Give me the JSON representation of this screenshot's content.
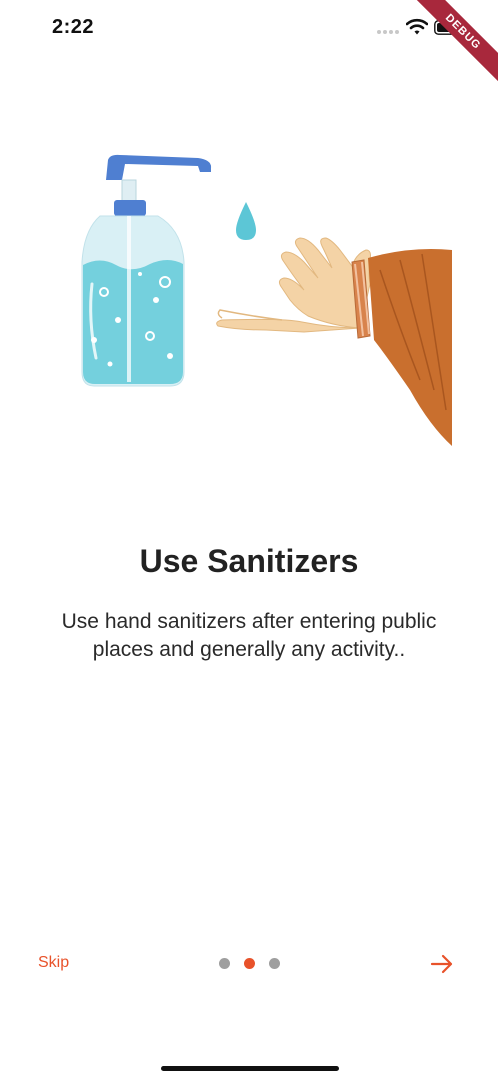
{
  "status_bar": {
    "time": "2:22"
  },
  "debug_banner": {
    "label": "DEBUG"
  },
  "slide": {
    "title": "Use Sanitizers",
    "description": "Use hand sanitizers after entering public places and generally any activity.."
  },
  "navigation": {
    "skip_label": "Skip",
    "page_indicator": {
      "count": 3,
      "active_index": 1
    },
    "next_icon": "arrow-right-icon"
  },
  "colors": {
    "accent": "#e8522a",
    "dot_inactive": "#9e9e9e",
    "text": "#222222"
  }
}
